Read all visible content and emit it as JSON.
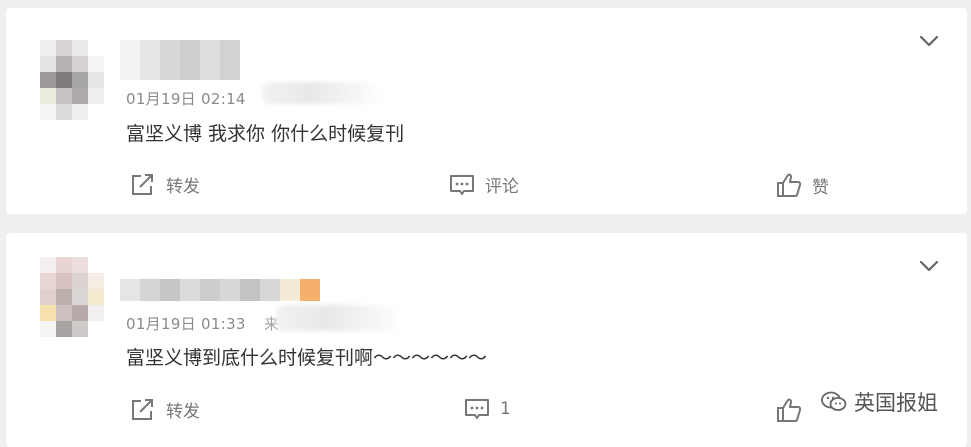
{
  "colors": {
    "background": "#efefef",
    "card": "#ffffff",
    "text": "#333333",
    "meta": "#8a8a8a",
    "action": "#777777"
  },
  "posts": [
    {
      "time": "01月19日 02:14",
      "content": "富坚义博 我求你 你什么时候复刊",
      "actions": {
        "repost_label": "转发",
        "comment_label": "评论",
        "like_label": "赞"
      }
    },
    {
      "time": "01月19日 01:33",
      "source_fragment": "来",
      "content": "富坚义博到底什么时候复刊啊～～～～～～",
      "actions": {
        "repost_label": "转发",
        "comment_label": "1",
        "like_label": ""
      }
    }
  ],
  "watermark": {
    "text": "英国报姐",
    "icon": "wechat-icon"
  },
  "icons": [
    "chevron-down-icon",
    "repost-icon",
    "comment-icon",
    "like-icon"
  ]
}
